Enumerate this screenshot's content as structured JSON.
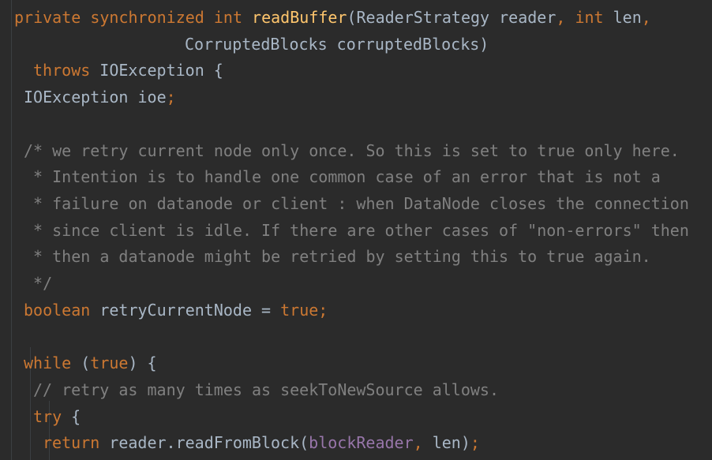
{
  "editor": {
    "language": "java",
    "theme": {
      "background": "#2b2b2b",
      "keyword": "#cc7832",
      "method": "#ffc66d",
      "field": "#9876aa",
      "comment": "#808080",
      "text": "#a9b7c6"
    },
    "lines": [
      {
        "indent": 0,
        "tokens": [
          {
            "t": "private synchronized int ",
            "c": "kw"
          },
          {
            "t": "readBuffer",
            "c": "fn"
          },
          {
            "t": "(ReaderStrategy reader",
            "c": "plain"
          },
          {
            "t": ", ",
            "c": "punct"
          },
          {
            "t": "int ",
            "c": "kw"
          },
          {
            "t": "len",
            "c": "plain"
          },
          {
            "t": ",",
            "c": "punct"
          }
        ]
      },
      {
        "indent": 18,
        "tokens": [
          {
            "t": "CorruptedBlocks corruptedBlocks)",
            "c": "plain"
          }
        ]
      },
      {
        "indent": 2,
        "tokens": [
          {
            "t": "throws ",
            "c": "kw"
          },
          {
            "t": "IOException {",
            "c": "plain"
          }
        ]
      },
      {
        "indent": 1,
        "tokens": [
          {
            "t": "IOException ioe",
            "c": "plain"
          },
          {
            "t": ";",
            "c": "punct"
          }
        ]
      },
      {
        "indent": 0,
        "tokens": []
      },
      {
        "indent": 1,
        "tokens": [
          {
            "t": "/* we retry current node only once. So this is set to true only here.",
            "c": "comment"
          }
        ]
      },
      {
        "indent": 1,
        "tokens": [
          {
            "t": " * Intention is to handle one common case of an error that is not a",
            "c": "comment"
          }
        ]
      },
      {
        "indent": 1,
        "tokens": [
          {
            "t": " * failure on datanode or client : when DataNode closes the connection",
            "c": "comment"
          }
        ]
      },
      {
        "indent": 1,
        "tokens": [
          {
            "t": " * since client is idle. If there are other cases of \"non-errors\" then",
            "c": "comment"
          }
        ]
      },
      {
        "indent": 1,
        "tokens": [
          {
            "t": " * then a datanode might be retried by setting this to true again.",
            "c": "comment"
          }
        ]
      },
      {
        "indent": 1,
        "tokens": [
          {
            "t": " */",
            "c": "comment"
          }
        ]
      },
      {
        "indent": 1,
        "tokens": [
          {
            "t": "boolean ",
            "c": "kw"
          },
          {
            "t": "retryCurrentNode = ",
            "c": "plain"
          },
          {
            "t": "true",
            "c": "kw"
          },
          {
            "t": ";",
            "c": "punct"
          }
        ]
      },
      {
        "indent": 0,
        "tokens": []
      },
      {
        "indent": 1,
        "tokens": [
          {
            "t": "while ",
            "c": "kw"
          },
          {
            "t": "(",
            "c": "plain"
          },
          {
            "t": "true",
            "c": "kw"
          },
          {
            "t": ") {",
            "c": "plain"
          }
        ]
      },
      {
        "indent": 2,
        "tokens": [
          {
            "t": "// retry as many times as seekToNewSource allows.",
            "c": "comment"
          }
        ]
      },
      {
        "indent": 2,
        "tokens": [
          {
            "t": "try ",
            "c": "kw"
          },
          {
            "t": "{",
            "c": "plain"
          }
        ]
      },
      {
        "indent": 3,
        "tokens": [
          {
            "t": "return ",
            "c": "kw"
          },
          {
            "t": "reader.readFromBlock(",
            "c": "plain"
          },
          {
            "t": "blockReader",
            "c": "field"
          },
          {
            "t": ", ",
            "c": "punct"
          },
          {
            "t": "len)",
            "c": "plain"
          },
          {
            "t": ";",
            "c": "punct"
          }
        ]
      }
    ]
  }
}
